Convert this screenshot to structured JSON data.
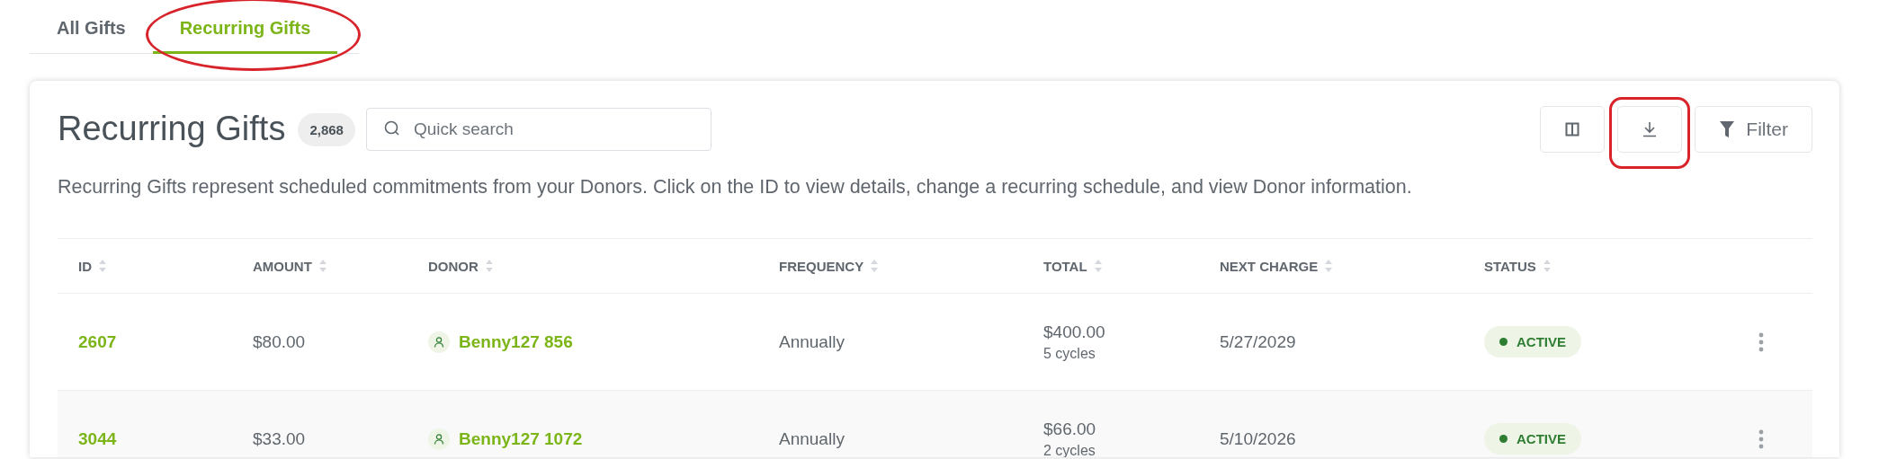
{
  "tabs": [
    {
      "label": "All Gifts",
      "selected": false,
      "annotated": false
    },
    {
      "label": "Recurring Gifts",
      "selected": true,
      "annotated": true
    }
  ],
  "header": {
    "title": "Recurring Gifts",
    "count": "2,868",
    "search": {
      "placeholder": "Quick search"
    },
    "description": "Recurring Gifts represent scheduled commitments from your Donors. Click on the ID to view details, change a recurring schedule, and view Donor information."
  },
  "toolbar": [
    {
      "kind": "columns",
      "annotated": false
    },
    {
      "kind": "download",
      "annotated": true
    },
    {
      "kind": "filter",
      "label": "Filter",
      "annotated": false
    }
  ],
  "table": {
    "columns": [
      "ID",
      "AMOUNT",
      "DONOR",
      "FREQUENCY",
      "TOTAL",
      "NEXT CHARGE",
      "STATUS"
    ],
    "rows": [
      {
        "id": "2607",
        "amount": "$80.00",
        "donor": "Benny127 856",
        "frequency": "Annually",
        "total": "$400.00",
        "cycles": "5 cycles",
        "next_charge": "5/27/2029",
        "status": {
          "label": "ACTIVE",
          "color": "#2e7d32"
        }
      },
      {
        "id": "3044",
        "amount": "$33.00",
        "donor": "Benny127 1072",
        "frequency": "Annually",
        "total": "$66.00",
        "cycles": "2 cycles",
        "next_charge": "5/10/2026",
        "status": {
          "label": "ACTIVE",
          "color": "#2e7d32"
        }
      }
    ]
  }
}
